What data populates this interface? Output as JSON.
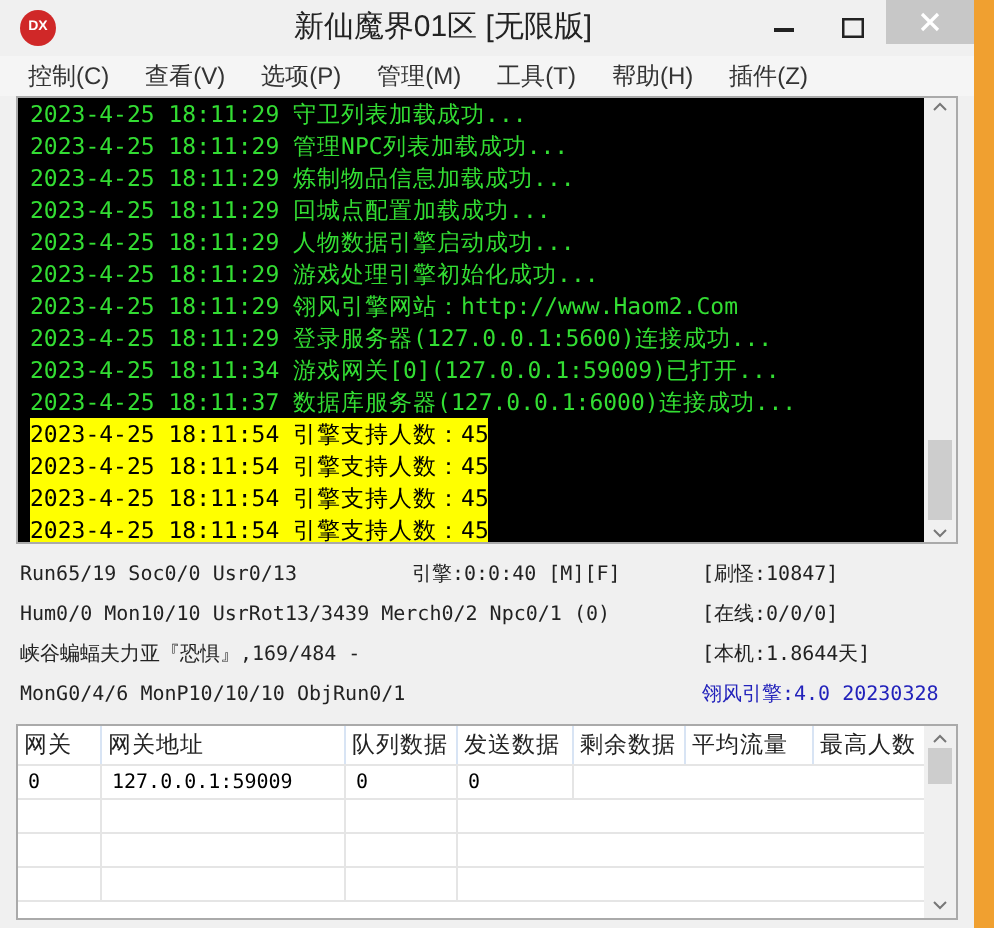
{
  "window": {
    "title": "新仙魔界01区 [无限版]",
    "app_icon": "DX"
  },
  "menu": [
    "控制(C)",
    "查看(V)",
    "选项(P)",
    "管理(M)",
    "工具(T)",
    "帮助(H)",
    "插件(Z)"
  ],
  "log": [
    {
      "time": "2023-4-25 18:11:29",
      "text": "守卫列表加载成功...",
      "kind": "normal"
    },
    {
      "time": "2023-4-25 18:11:29",
      "text": "管理NPC列表加载成功...",
      "kind": "normal"
    },
    {
      "time": "2023-4-25 18:11:29",
      "text": "炼制物品信息加载成功...",
      "kind": "normal"
    },
    {
      "time": "2023-4-25 18:11:29",
      "text": "回城点配置加载成功...",
      "kind": "normal"
    },
    {
      "time": "2023-4-25 18:11:29",
      "text": "人物数据引擎启动成功...",
      "kind": "normal"
    },
    {
      "time": "2023-4-25 18:11:29",
      "text": "游戏处理引擎初始化成功...",
      "kind": "normal"
    },
    {
      "time": "2023-4-25 18:11:29",
      "text": "翎风引擎网站：http://www.Haom2.Com",
      "kind": "normal"
    },
    {
      "time": "2023-4-25 18:11:29",
      "text": "登录服务器(127.0.0.1:5600)连接成功...",
      "kind": "normal"
    },
    {
      "time": "2023-4-25 18:11:34",
      "text": "游戏网关[0](127.0.0.1:59009)已打开...",
      "kind": "normal"
    },
    {
      "time": "2023-4-25 18:11:37",
      "text": "数据库服务器(127.0.0.1:6000)连接成功...",
      "kind": "normal"
    },
    {
      "time": "2023-4-25 18:11:54",
      "text": "引擎支持人数：45",
      "kind": "highlight"
    },
    {
      "time": "2023-4-25 18:11:54",
      "text": "引擎支持人数：45",
      "kind": "highlight"
    },
    {
      "time": "2023-4-25 18:11:54",
      "text": "引擎支持人数：45",
      "kind": "highlight"
    },
    {
      "time": "2023-4-25 18:11:54",
      "text": "引擎支持人数：45",
      "kind": "highlight"
    }
  ],
  "status": [
    {
      "left": "Run65/19 Soc0/0 Usr0/13",
      "middle": "引擎:0:0:40 [M][F]",
      "right": "[刷怪:10847]",
      "kind": "normal"
    },
    {
      "left": "Hum0/0 Mon10/10 UsrRot13/3439 Merch0/2 Npc0/1 (0)",
      "right": "[在线:0/0/0]",
      "kind": "normal"
    },
    {
      "left": "峡谷蝙蝠夫力亚『恐惧』,169/484 -",
      "right": "[本机:1.8644天]",
      "kind": "normal"
    },
    {
      "left": "MonG0/4/6 MonP10/10/10 ObjRun0/1",
      "right": "翎风引擎:4.0 20230328",
      "kind": "version"
    }
  ],
  "table": {
    "columns": [
      "网关",
      "网关地址",
      "队列数据",
      "发送数据",
      "剩余数据",
      "平均流量",
      "最高人数"
    ],
    "rows": [
      [
        "0",
        "127.0.0.1:59009",
        "0",
        "0"
      ]
    ]
  }
}
